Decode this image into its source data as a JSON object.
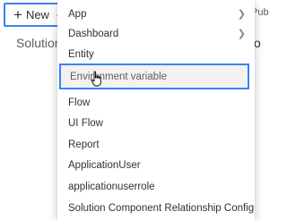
{
  "toolbar": {
    "new_label": "New",
    "partial_right": "Pub"
  },
  "page": {
    "title": "Solutions",
    "right_partial": "o"
  },
  "menu": {
    "items": [
      {
        "label": "App",
        "has_submenu": true
      },
      {
        "label": "Dashboard",
        "has_submenu": true
      },
      {
        "label": "Entity",
        "has_submenu": false
      },
      {
        "label": "Environment variable",
        "has_submenu": false,
        "highlighted": true
      },
      {
        "label": "Flow",
        "has_submenu": false
      },
      {
        "label": "UI Flow",
        "has_submenu": false
      },
      {
        "label": "Report",
        "has_submenu": false
      },
      {
        "label": "ApplicationUser",
        "has_submenu": false
      },
      {
        "label": "applicationuserrole",
        "has_submenu": false
      },
      {
        "label": "Solution Component Relationship Configuration",
        "has_submenu": false
      }
    ]
  },
  "icons": {
    "plus": "plus-icon",
    "chevron_down": "chevron-down-icon",
    "chevron_right": "chevron-right-icon",
    "cursor": "hand-pointer-icon"
  },
  "colors": {
    "highlight_border": "#3b82f6",
    "hover_background": "#f3f2f1"
  }
}
